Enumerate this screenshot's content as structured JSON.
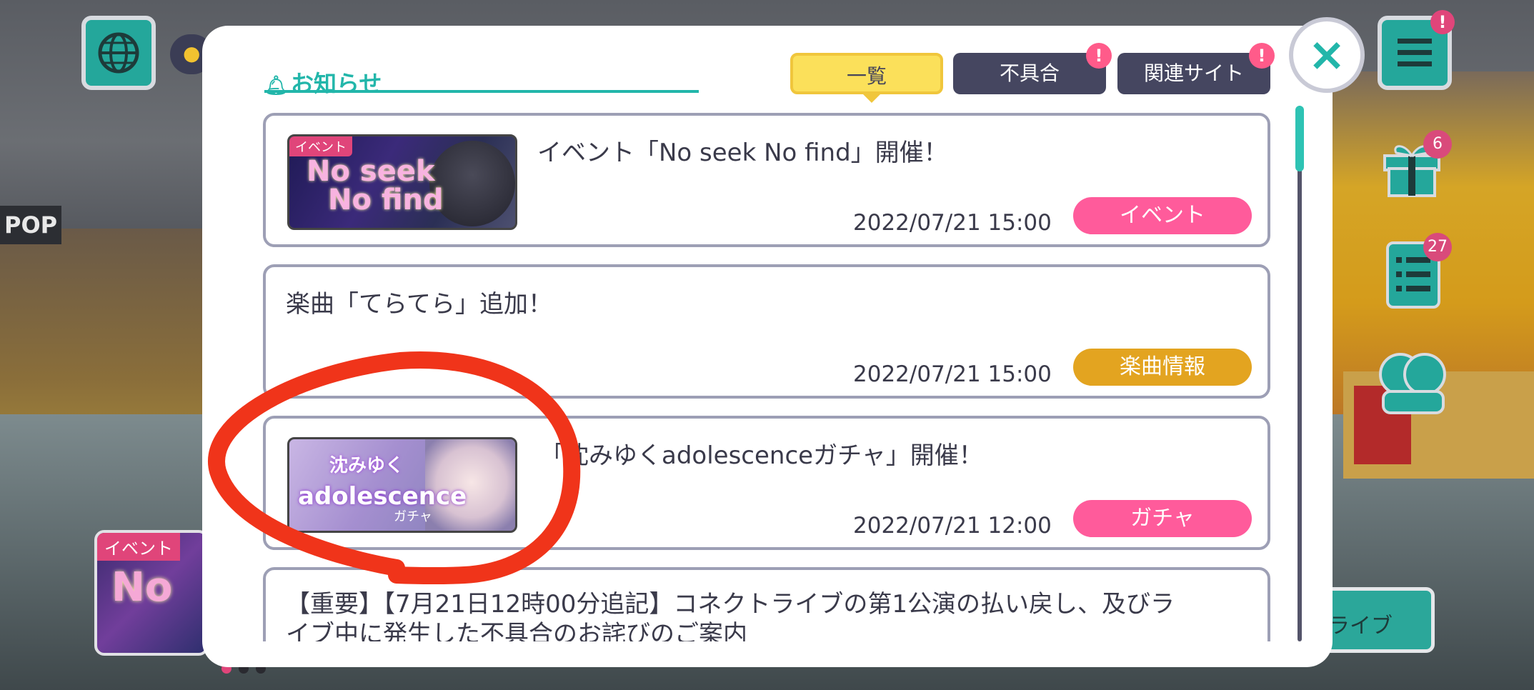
{
  "header": {
    "title": "お知らせ",
    "bell_icon": "bell-icon"
  },
  "tabs": [
    {
      "label": "一覧",
      "active": true
    },
    {
      "label": "不具合",
      "alert": "!"
    },
    {
      "label": "関連サイト",
      "alert": "!"
    }
  ],
  "close": {
    "icon": "×"
  },
  "news": [
    {
      "title": "イベント「No seek No find」開催！",
      "date": "2022/07/21 15:00",
      "category": "イベント",
      "category_color": "#ff5b9b",
      "thumb_tag": "イベント",
      "thumb_logo_line1": "No seek",
      "thumb_logo_line2": "No find"
    },
    {
      "title": "楽曲「てらてら」追加！",
      "date": "2022/07/21 15:00",
      "category": "楽曲情報",
      "category_color": "#e3a420"
    },
    {
      "title": "「沈みゆくadolescenceガチャ」開催！",
      "date": "2022/07/21 12:00",
      "category": "ガチャ",
      "category_color": "#ff5b9b",
      "thumb_logo_line1": "沈みゆく",
      "thumb_logo_line2": "adolescence",
      "thumb_logo_line3": "ガチャ"
    },
    {
      "title_line1": "【重要】【7月21日12時00分追記】コネクトライブの第1公演の払い戻し、及びラ",
      "title_line2": "イブ中に発生した不具合のお詫びのご案内"
    }
  ],
  "background": {
    "pop_sign": "POP",
    "live_button": "ライブ",
    "event_card_tag": "イベント",
    "event_card_logo": "No",
    "menu_alert": "!",
    "gift_count": "6",
    "mission_count": "27"
  },
  "colors": {
    "accent_teal": "#22b6aa",
    "tab_active": "#fbe05a",
    "tab_inactive": "#454660",
    "alert_pink": "#ff5b8a",
    "marker_red": "#f0341a"
  }
}
